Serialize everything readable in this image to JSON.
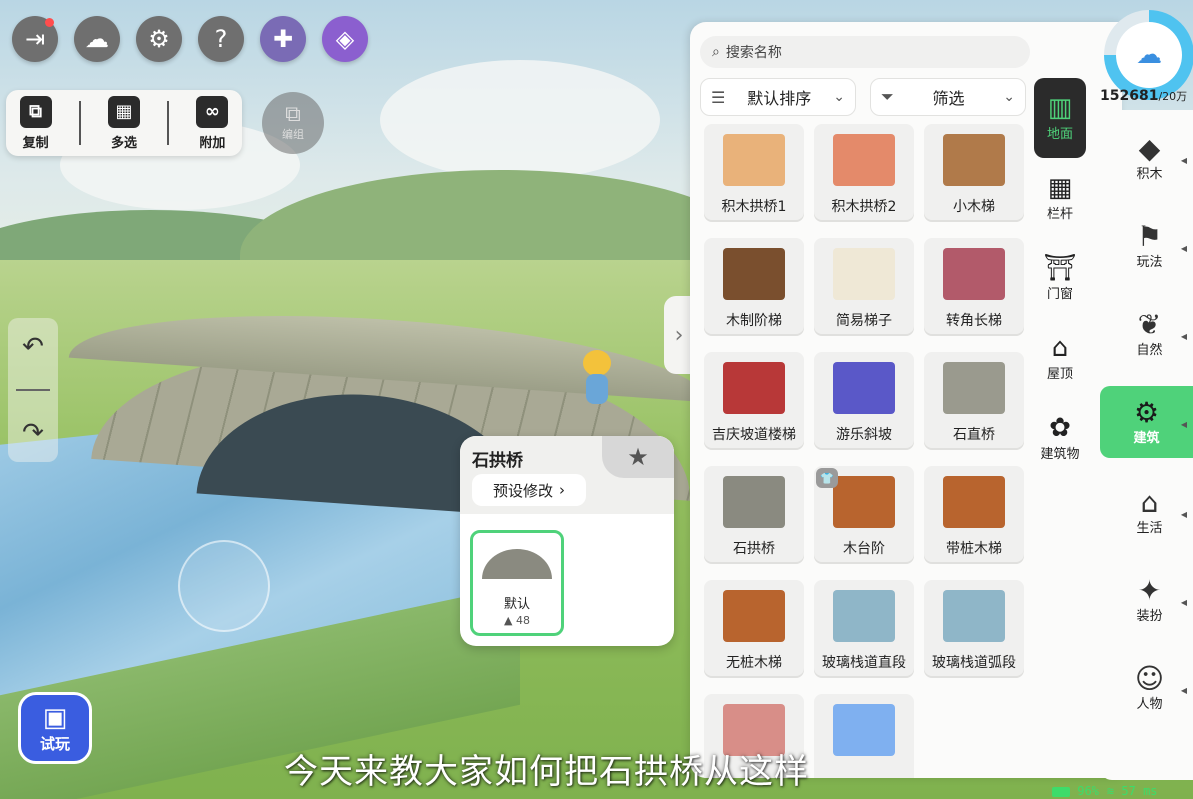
{
  "toolbar": {
    "icons": [
      "exit-icon",
      "cloud-upload-icon",
      "settings-icon",
      "help-icon",
      "puzzle-icon",
      "cube-icon"
    ],
    "edit_actions": [
      {
        "label": "复制",
        "icon": "copy-icon"
      },
      {
        "label": "多选",
        "icon": "multi-select-icon"
      },
      {
        "label": "附加",
        "icon": "attach-icon"
      }
    ],
    "group_label": "编组"
  },
  "popup": {
    "title": "石拱桥",
    "preset_label": "预设修改",
    "variant": {
      "name": "默认",
      "count": "48"
    }
  },
  "panel": {
    "search_placeholder": "搜索名称",
    "sort_label": "默认排序",
    "filter_label": "筛选",
    "items": [
      {
        "label": "积木拱桥1",
        "color": "#e9b27a"
      },
      {
        "label": "积木拱桥2",
        "color": "#e48a6a"
      },
      {
        "label": "小木梯",
        "color": "#b07a4a"
      },
      {
        "label": "木制阶梯",
        "color": "#7a4f2e"
      },
      {
        "label": "简易梯子",
        "color": "#efe8d6"
      },
      {
        "label": "转角长梯",
        "color": "#b25a6a"
      },
      {
        "label": "吉庆坡道楼梯",
        "color": "#b83838"
      },
      {
        "label": "游乐斜坡",
        "color": "#5a58c8"
      },
      {
        "label": "石直桥",
        "color": "#9a9a8e"
      },
      {
        "label": "石拱桥",
        "color": "#8a8a80"
      },
      {
        "label": "木台阶",
        "color": "#b8642e"
      },
      {
        "label": "带桩木梯",
        "color": "#b8642e"
      },
      {
        "label": "无桩木梯",
        "color": "#b8642e"
      },
      {
        "label": "玻璃栈道直段",
        "color": "#8fb6c8"
      },
      {
        "label": "玻璃栈道弧段",
        "color": "#8fb6c8"
      },
      {
        "label": "",
        "color": "#d88e88"
      },
      {
        "label": "",
        "color": "#7fb0f0"
      }
    ],
    "categories": [
      {
        "label": "地面",
        "icon": "floor-icon",
        "active": true
      },
      {
        "label": "栏杆",
        "icon": "railing-icon",
        "active": false
      },
      {
        "label": "门窗",
        "icon": "door-icon",
        "active": false
      },
      {
        "label": "屋顶",
        "icon": "roof-icon",
        "active": false
      },
      {
        "label": "建筑物",
        "icon": "building-icon",
        "active": false
      }
    ]
  },
  "rail": {
    "counter": "152681",
    "counter_suffix": "/20万",
    "items": [
      {
        "label": "积木",
        "icon": "blocks-icon",
        "active": false
      },
      {
        "label": "玩法",
        "icon": "gameplay-icon",
        "active": false
      },
      {
        "label": "自然",
        "icon": "nature-icon",
        "active": false
      },
      {
        "label": "建筑",
        "icon": "building-gear-icon",
        "active": true
      },
      {
        "label": "生活",
        "icon": "home-icon",
        "active": false
      },
      {
        "label": "装扮",
        "icon": "decor-icon",
        "active": false
      },
      {
        "label": "人物",
        "icon": "character-icon",
        "active": false
      }
    ]
  },
  "try_button": {
    "label": "试玩"
  },
  "subtitle": "今天来教大家如何把石拱桥从这样",
  "status": {
    "battery": "96%",
    "ping": "57 ms"
  }
}
